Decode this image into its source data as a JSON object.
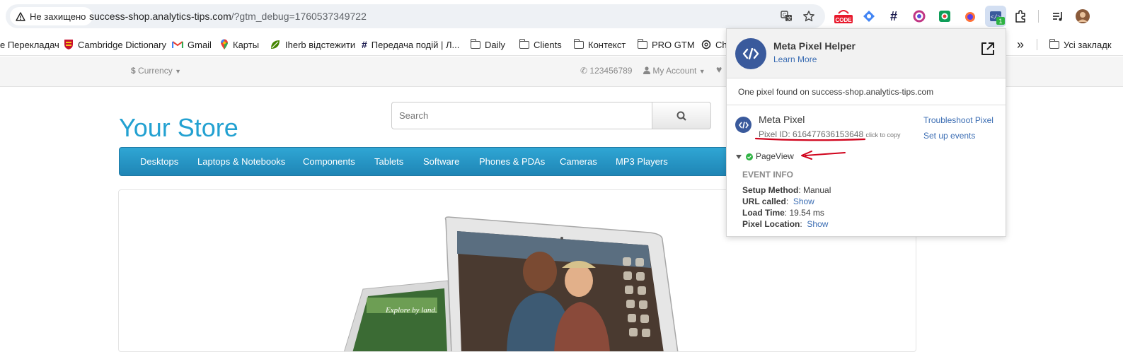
{
  "browser": {
    "security_label": "Не захищено",
    "url_host": "success-shop.analytics-tips.com",
    "url_rest": "/?gtm_debug=1760537349722",
    "code_ext_label": "CODE",
    "pixel_badge": "1"
  },
  "bookmarks": {
    "items": [
      {
        "label": "e Перекладач"
      },
      {
        "label": "Cambridge Dictionary"
      },
      {
        "label": "Gmail"
      },
      {
        "label": "Карты"
      },
      {
        "label": "Iherb відстежити"
      },
      {
        "label": "Передача подій | Л..."
      },
      {
        "label": "Daily"
      },
      {
        "label": "Clients"
      },
      {
        "label": "Контекст"
      },
      {
        "label": "PRO GTM"
      },
      {
        "label": "Ch"
      }
    ],
    "more": "»",
    "all_bookmarks": "Усі закладк"
  },
  "store": {
    "currency": "Currency",
    "phone": "123456789",
    "my_account": "My Account",
    "logo": "Your Store",
    "search_placeholder": "Search",
    "menu": [
      "Desktops",
      "Laptops & Notebooks",
      "Components",
      "Tablets",
      "Software",
      "Phones & PDAs",
      "Cameras",
      "MP3 Players"
    ],
    "slide_caption": "Explore by land."
  },
  "popup": {
    "title": "Meta Pixel Helper",
    "learn_more": "Learn More",
    "summary": "One pixel found on success-shop.analytics-tips.com",
    "pixel_name": "Meta Pixel",
    "pixel_id_label": "Pixel ID: 616477636153648",
    "click_to_copy": "click to copy",
    "troubleshoot": "Troubleshoot Pixel",
    "setup_events": "Set up events",
    "event_name": "PageView",
    "event_info_heading": "EVENT INFO",
    "rows": [
      {
        "key": "Setup Method",
        "value": "Manual",
        "link": false
      },
      {
        "key": "URL called",
        "value": "Show",
        "link": true
      },
      {
        "key": "Load Time",
        "value": "19.54 ms",
        "link": false
      },
      {
        "key": "Pixel Location",
        "value": "Show",
        "link": true
      }
    ]
  },
  "colors": {
    "store_blue": "#23a1d1",
    "menu_blue": "#229ac8",
    "pixel_blue": "#3a5a9c",
    "annotation_red": "#d0021b",
    "success_green": "#2fb344"
  }
}
